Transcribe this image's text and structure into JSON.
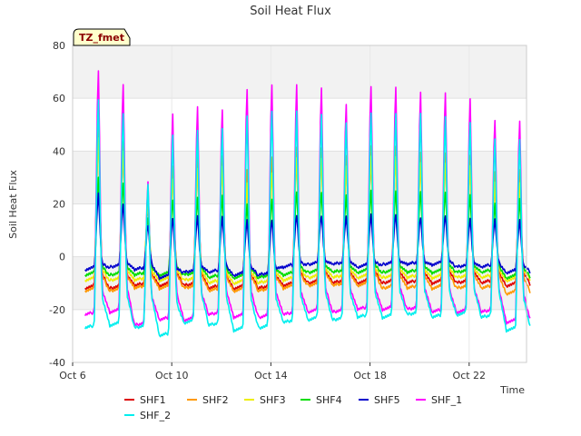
{
  "chart_data": {
    "type": "line",
    "title": "Soil Heat Flux",
    "xlabel": "Time",
    "ylabel": "Soil Heat Flux",
    "badge": "TZ_fmet",
    "ylim": [
      -40,
      80
    ],
    "yticks": [
      -40,
      -20,
      0,
      20,
      40,
      60,
      80
    ],
    "xlim": [
      "2021-10-06",
      "2021-10-25"
    ],
    "xticks": [
      {
        "date": "2021-10-06",
        "label": "Oct 6"
      },
      {
        "date": "2021-10-10",
        "label": "Oct 10"
      },
      {
        "date": "2021-10-14",
        "label": "Oct 14"
      },
      {
        "date": "2021-10-18",
        "label": "Oct 18"
      },
      {
        "date": "2021-10-22",
        "label": "Oct 22"
      }
    ],
    "grid": true,
    "legend_position": "bottom",
    "days": [
      "2021-10-06",
      "2021-10-07",
      "2021-10-08",
      "2021-10-09",
      "2021-10-10",
      "2021-10-11",
      "2021-10-12",
      "2021-10-13",
      "2021-10-14",
      "2021-10-15",
      "2021-10-16",
      "2021-10-17",
      "2021-10-18",
      "2021-10-19",
      "2021-10-20",
      "2021-10-21",
      "2021-10-22",
      "2021-10-23"
    ],
    "series": [
      {
        "name": "SHF1",
        "color": "#dd0000",
        "daily_min": [
          -12,
          -12,
          -11,
          -11,
          -11,
          -12,
          -12,
          -12,
          -11,
          -10,
          -10,
          -10,
          -10,
          -10,
          -10,
          -10,
          -10,
          -11
        ],
        "daily_max": [
          48,
          42,
          20,
          33,
          35,
          36,
          30,
          35,
          40,
          40,
          36,
          40,
          40,
          38,
          38,
          36,
          30,
          30
        ]
      },
      {
        "name": "SHF2",
        "color": "#ff9900",
        "daily_min": [
          -13,
          -13,
          -12,
          -12,
          -12,
          -13,
          -13,
          -13,
          -12,
          -11,
          -11,
          -11,
          -12,
          -12,
          -12,
          -12,
          -12,
          -14
        ],
        "daily_max": [
          50,
          45,
          22,
          35,
          38,
          38,
          33,
          38,
          42,
          42,
          38,
          42,
          42,
          40,
          40,
          38,
          32,
          33
        ]
      },
      {
        "name": "SHF3",
        "color": "#eeee00",
        "daily_min": [
          -9,
          -9,
          -9,
          -9,
          -9,
          -10,
          -10,
          -10,
          -9,
          -8,
          -8,
          -8,
          -8,
          -8,
          -8,
          -8,
          -8,
          -9
        ],
        "daily_max": [
          45,
          40,
          20,
          30,
          33,
          34,
          28,
          32,
          38,
          38,
          34,
          38,
          38,
          36,
          36,
          34,
          28,
          28
        ]
      },
      {
        "name": "SHF4",
        "color": "#00dd00",
        "daily_min": [
          -7,
          -7,
          -7,
          -7,
          -7,
          -8,
          -8,
          -8,
          -7,
          -6,
          -6,
          -6,
          -6,
          -6,
          -6,
          -6,
          -6,
          -8
        ],
        "daily_max": [
          30,
          28,
          15,
          22,
          22,
          23,
          20,
          22,
          25,
          25,
          23,
          25,
          25,
          25,
          25,
          23,
          20,
          22
        ]
      },
      {
        "name": "SHF5",
        "color": "#0000cc",
        "daily_min": [
          -5,
          -4,
          -5,
          -8,
          -6,
          -6,
          -7,
          -7,
          -4,
          -3,
          -3,
          -4,
          -3,
          -3,
          -3,
          -4,
          -4,
          -6
        ],
        "daily_max": [
          24,
          20,
          12,
          15,
          15,
          15,
          14,
          14,
          16,
          16,
          15,
          16,
          16,
          15,
          16,
          14,
          14,
          14
        ]
      },
      {
        "name": "SHF_1",
        "color": "#ff00ff",
        "daily_min": [
          -22,
          -21,
          -26,
          -24,
          -24,
          -22,
          -23,
          -23,
          -22,
          -21,
          -21,
          -20,
          -20,
          -20,
          -21,
          -21,
          -21,
          -25
        ],
        "daily_max": [
          71,
          66,
          28,
          54,
          57,
          56,
          64,
          66,
          65,
          64,
          58,
          65,
          65,
          62,
          62,
          60,
          52,
          52
        ]
      },
      {
        "name": "SHF_2",
        "color": "#00eeee",
        "daily_min": [
          -27,
          -26,
          -27,
          -30,
          -25,
          -26,
          -28,
          -27,
          -25,
          -24,
          -24,
          -23,
          -23,
          -22,
          -23,
          -22,
          -23,
          -28
        ],
        "daily_max": [
          60,
          55,
          27,
          46,
          48,
          49,
          54,
          56,
          55,
          54,
          51,
          55,
          55,
          54,
          53,
          51,
          45,
          45
        ]
      }
    ]
  }
}
